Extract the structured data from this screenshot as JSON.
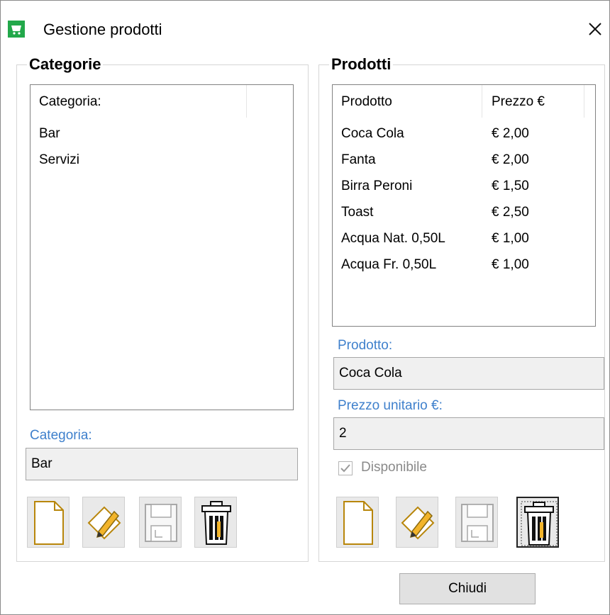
{
  "window": {
    "title": "Gestione prodotti"
  },
  "categories_panel": {
    "group_title": "Categorie",
    "list_header": "Categoria:",
    "items": [
      "Bar",
      "Servizi"
    ],
    "field_label": "Categoria:",
    "field_value": "Bar"
  },
  "products_panel": {
    "group_title": "Prodotti",
    "columns": [
      "Prodotto",
      "Prezzo €"
    ],
    "rows": [
      [
        "Coca Cola",
        "€ 2,00"
      ],
      [
        "Fanta",
        "€ 2,00"
      ],
      [
        "Birra Peroni",
        "€ 1,50"
      ],
      [
        "Toast",
        "€ 2,50"
      ],
      [
        "Acqua Nat. 0,50L",
        "€ 1,00"
      ],
      [
        "Acqua Fr. 0,50L",
        "€ 1,00"
      ]
    ],
    "product_label": "Prodotto:",
    "product_value": "Coca Cola",
    "price_label": "Prezzo unitario €:",
    "price_value": "2",
    "available_label": "Disponibile",
    "available_checked": true
  },
  "footer": {
    "close_label": "Chiudi"
  },
  "icons": {
    "app": "shopping-cart-icon",
    "close": "close-icon",
    "new": "new-document-icon",
    "edit": "edit-pencil-icon",
    "save": "save-floppy-icon",
    "delete": "trash-bin-icon"
  },
  "colors": {
    "accent_label": "#3f80cc",
    "app_icon": "#22a84a"
  }
}
